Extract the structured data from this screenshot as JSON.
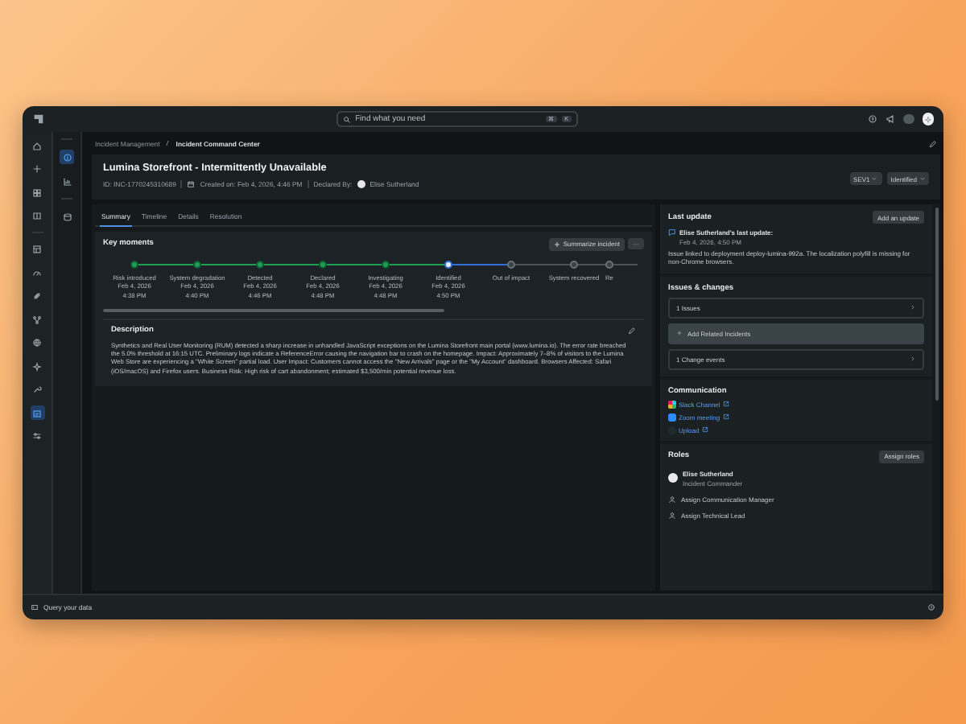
{
  "topbar": {
    "search_placeholder": "Find what you need",
    "shortcut_keys": [
      "⌘",
      "K"
    ]
  },
  "rail": [
    {
      "selected": false
    },
    {
      "selected": false
    },
    {
      "selected": false
    },
    {
      "selected": false
    },
    {
      "selected": false
    },
    {
      "selected": false
    },
    {
      "selected": false
    },
    {
      "selected": false
    },
    {
      "selected": false
    },
    {
      "selected": false
    },
    {
      "selected": false
    },
    {
      "selected": true
    },
    {
      "selected": false
    }
  ],
  "subrail": [
    {
      "selected": true
    },
    {
      "selected": false
    },
    {
      "selected": false
    }
  ],
  "breadcrumb": [
    "Incident Management",
    "Incident Command Center"
  ],
  "incident": {
    "title": "Lumina Storefront - Intermittently Unavailable",
    "id": "ID: INC-1770245310689",
    "created": "Created on: Feb 4, 2026, 4:46 PM",
    "declared_label": "Declared By:",
    "declared_by": "Elise Sutherland",
    "severity": "SEV1",
    "status": "Identified"
  },
  "tabs": [
    {
      "label": "Summary",
      "selected": true
    },
    {
      "label": "Timeline",
      "selected": false
    },
    {
      "label": "Details",
      "selected": false
    },
    {
      "label": "Resolution",
      "selected": false
    }
  ],
  "key_moments": {
    "title": "Key moments",
    "summarize_button": "Summarize incident",
    "steps": [
      {
        "label": "Risk introduced",
        "date": "Feb 4, 2026",
        "time": "4:38 PM",
        "completed": true,
        "current": false
      },
      {
        "label": "System degradation",
        "date": "Feb 4, 2026",
        "time": "4:40 PM",
        "completed": true,
        "current": false
      },
      {
        "label": "Detected",
        "date": "Feb 4, 2026",
        "time": "4:46 PM",
        "completed": true,
        "current": false
      },
      {
        "label": "Declared",
        "date": "Feb 4, 2026",
        "time": "4:48 PM",
        "completed": true,
        "current": false
      },
      {
        "label": "Investigating",
        "date": "Feb 4, 2026",
        "time": "4:48 PM",
        "completed": true,
        "current": false
      },
      {
        "label": "Identified",
        "date": "Feb 4, 2026",
        "time": "4:50 PM",
        "completed": false,
        "current": true
      },
      {
        "label": "Out of impact",
        "completed": false,
        "current": false
      },
      {
        "label": "System recovered",
        "completed": false,
        "current": false
      },
      {
        "label": "Re",
        "completed": false,
        "current": false
      }
    ]
  },
  "description": {
    "title": "Description",
    "text": "Synthetics and Real User Monitoring (RUM) detected a sharp increase in unhandled JavaScript exceptions on the Lumina Storefront main portal (www.lumina.io). The error rate breached the 5.0% threshold at 16:15 UTC. Preliminary logs indicate a ReferenceError causing the navigation bar to crash on the homepage. Impact: Approximately 7–8% of visitors to the Lumina Web Store are experiencing a \"White Screen\" partial load. User Impact: Customers cannot access the \"New Arrivals\" page or the \"My Account\" dashboard. Browsers Affected: Safari (iOS/macOS) and Firefox users. Business Risk: High risk of cart abandonment; estimated $3,500/min potential revenue loss."
  },
  "last_update": {
    "title": "Last update",
    "button": "Add an update",
    "author": "Elise Sutherland's last update:",
    "time": "Feb 4, 2026, 4:50 PM",
    "text": "Issue linked to deployment deploy-lumina-992a. The localization polyfill is missing for non-Chrome browsers."
  },
  "issues_changes": {
    "title": "Issues & changes",
    "rows": [
      {
        "kind": "link",
        "label": "1 Issues"
      },
      {
        "kind": "add",
        "label": "Add Related Incidents"
      },
      {
        "kind": "link",
        "label": "1 Change events"
      }
    ]
  },
  "communication": {
    "title": "Communication",
    "links": [
      {
        "kind": "slack",
        "label": "Slack Channel"
      },
      {
        "kind": "zoom",
        "label": "Zoom meeting"
      },
      {
        "kind": "upload",
        "label": "Upload"
      }
    ]
  },
  "roles": {
    "title": "Roles",
    "button": "Assign roles",
    "assigned": [
      {
        "name": "Elise Sutherland",
        "role": "Incident Commander"
      }
    ],
    "unassigned": [
      "Assign Communication Manager",
      "Assign Technical Lead"
    ]
  },
  "bottom_bar": {
    "query": "Query your data"
  }
}
